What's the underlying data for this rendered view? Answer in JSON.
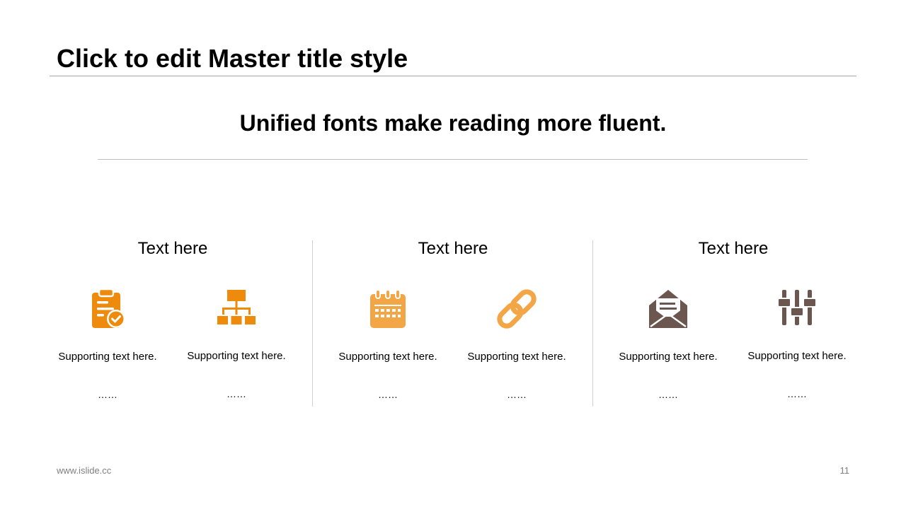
{
  "slide": {
    "title": "Click to edit Master title style",
    "subtitle": "Unified fonts make reading more fluent.",
    "footer_url": "www.islide.cc",
    "page_number": "11"
  },
  "colors": {
    "orange_dark": "#ee8a0c",
    "orange_light": "#f2a645",
    "brown": "#6b5650"
  },
  "columns": [
    {
      "heading": "Text here",
      "items": [
        {
          "icon": "clipboard-check-icon",
          "text": "Supporting  text here.",
          "dots": "……"
        },
        {
          "icon": "org-chart-icon",
          "text": "Supporting  text here.",
          "dots": "……"
        }
      ]
    },
    {
      "heading": "Text here",
      "items": [
        {
          "icon": "calendar-icon",
          "text": "Supporting  text here.",
          "dots": "……"
        },
        {
          "icon": "link-icon",
          "text": "Supporting  text here.",
          "dots": "……"
        }
      ]
    },
    {
      "heading": "Text here",
      "items": [
        {
          "icon": "envelope-open-icon",
          "text": "Supporting  text here.",
          "dots": "……"
        },
        {
          "icon": "sliders-icon",
          "text": "Supporting  text here.",
          "dots": "……"
        }
      ]
    }
  ]
}
